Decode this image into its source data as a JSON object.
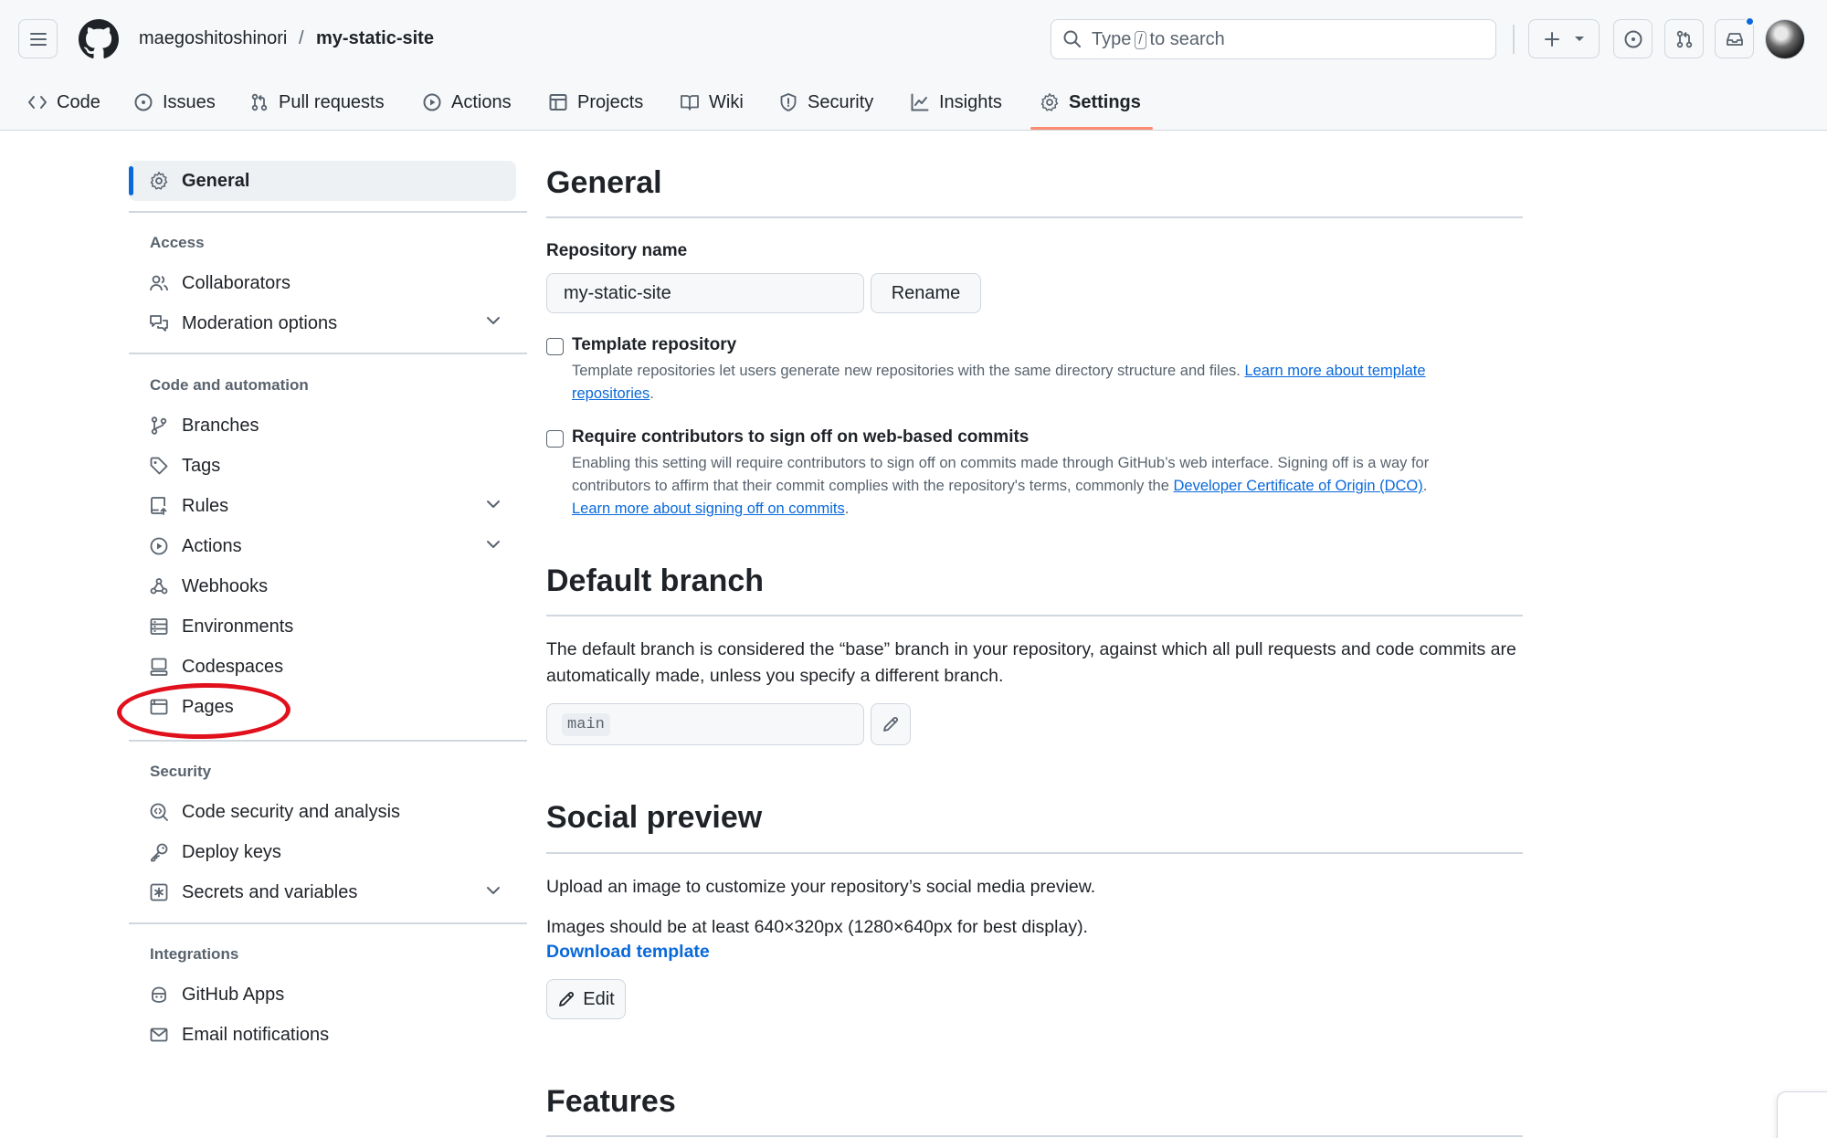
{
  "header": {
    "owner": "maegoshitoshinori",
    "separator": "/",
    "repo": "my-static-site",
    "search": {
      "prefix": "Type",
      "key": "/",
      "suffix": "to search"
    }
  },
  "tabs": [
    {
      "label": "Code",
      "icon": "code-icon"
    },
    {
      "label": "Issues",
      "icon": "issue-opened-icon"
    },
    {
      "label": "Pull requests",
      "icon": "git-pull-request-icon"
    },
    {
      "label": "Actions",
      "icon": "play-icon"
    },
    {
      "label": "Projects",
      "icon": "table-icon"
    },
    {
      "label": "Wiki",
      "icon": "book-icon"
    },
    {
      "label": "Security",
      "icon": "shield-icon"
    },
    {
      "label": "Insights",
      "icon": "graph-icon"
    },
    {
      "label": "Settings",
      "icon": "gear-icon",
      "active": true
    }
  ],
  "sidebar": {
    "general": "General",
    "sections": {
      "access": "Access",
      "code_automation": "Code and automation",
      "security": "Security",
      "integrations": "Integrations"
    },
    "items": {
      "collaborators": "Collaborators",
      "moderation": "Moderation options",
      "branches": "Branches",
      "tags": "Tags",
      "rules": "Rules",
      "actions": "Actions",
      "webhooks": "Webhooks",
      "environments": "Environments",
      "codespaces": "Codespaces",
      "pages": "Pages",
      "code_security": "Code security and analysis",
      "deploy_keys": "Deploy keys",
      "secrets": "Secrets and variables",
      "github_apps": "GitHub Apps",
      "email_notifications": "Email notifications"
    }
  },
  "main": {
    "general_title": "General",
    "repo_name_label": "Repository name",
    "repo_name_value": "my-static-site",
    "rename_button": "Rename",
    "template": {
      "title": "Template repository",
      "desc": "Template repositories let users generate new repositories with the same directory structure and files.",
      "link1": "Learn more about template",
      "link2": "repositories",
      "end": "."
    },
    "signoff": {
      "title": "Require contributors to sign off on web-based commits",
      "desc_line1": "Enabling this setting will require contributors to sign off on commits made through GitHub’s web interface. Signing off is a way for",
      "desc_line2": "contributors to affirm that their commit complies with the repository's terms, commonly the",
      "dco_link": "Developer Certificate of Origin (DCO)",
      "dot": ".",
      "learn_link": "Learn more about signing off on commits",
      "end": "."
    },
    "default_branch_title": "Default branch",
    "default_branch_desc": "The default branch is considered the “base” branch in your repository, against which all pull requests and code commits are automatically made, unless you specify a different branch.",
    "branch_value": "main",
    "social_title": "Social preview",
    "social_desc1": "Upload an image to customize your repository’s social media preview.",
    "social_desc2": "Images should be at least 640×320px (1280×640px for best display).",
    "download_template": "Download template",
    "edit_button": "Edit",
    "features_title": "Features"
  },
  "colors": {
    "accent": "#0969da",
    "tab_underline": "#fd8c73",
    "annotation_red": "#e0101c"
  }
}
